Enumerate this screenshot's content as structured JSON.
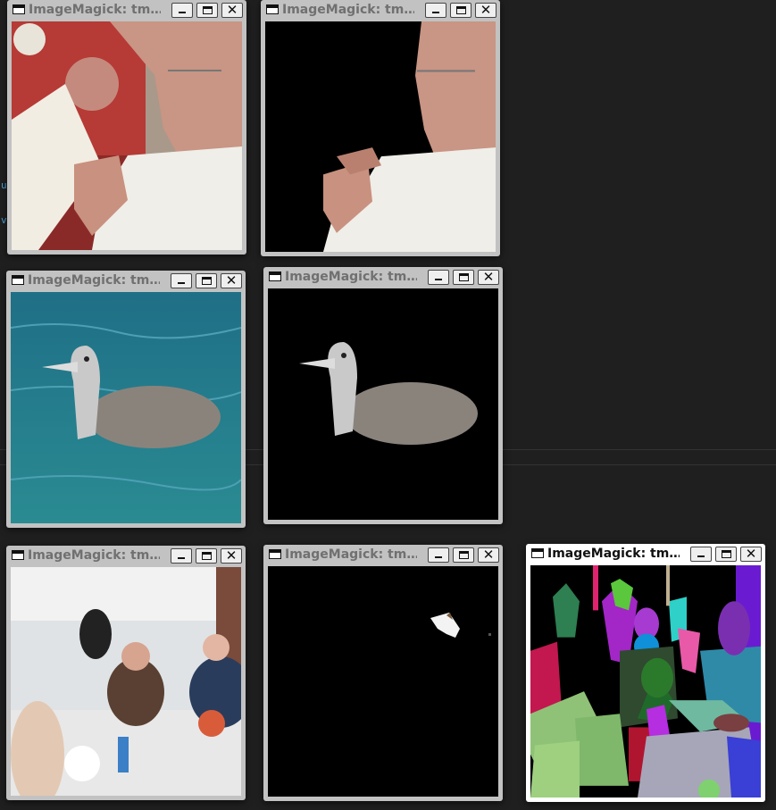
{
  "desktop": {
    "strip_chars": [
      "u",
      "v"
    ]
  },
  "windows": [
    {
      "title": "ImageMagick: tm…",
      "image": "photo-man-reading",
      "active": false
    },
    {
      "title": "ImageMagick: tm…",
      "image": "mask-man-reading",
      "active": false
    },
    {
      "title": "ImageMagick: tm…",
      "image": "photo-bird-water",
      "active": false
    },
    {
      "title": "ImageMagick: tm…",
      "image": "mask-bird",
      "active": false
    },
    {
      "title": "ImageMagick: tm…",
      "image": "photo-cafeteria",
      "active": false
    },
    {
      "title": "ImageMagick: tm…",
      "image": "mask-cafeteria",
      "active": false
    },
    {
      "title": "ImageMagick: tm…",
      "image": "segmentation-cafeteria",
      "active": true
    }
  ],
  "buttons": {
    "minimize": "_",
    "maximize": "□",
    "close": "✕"
  },
  "colors": {
    "desktop": "#1f1f1f",
    "inactive_frame": "#c2c2c2",
    "active_frame": "#ffffff"
  }
}
